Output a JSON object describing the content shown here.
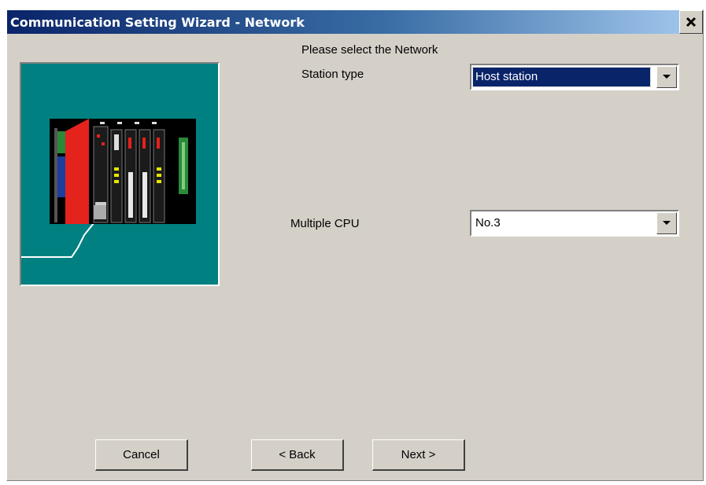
{
  "window": {
    "title": "Communication Setting Wizard - Network"
  },
  "content": {
    "instruction": "Please select the Network",
    "station_type": {
      "label": "Station type",
      "value": "Host station"
    },
    "multiple_cpu": {
      "label": "Multiple CPU",
      "value": "No.3"
    }
  },
  "buttons": {
    "cancel": "Cancel",
    "back": "< Back",
    "next": "Next >"
  },
  "colors": {
    "title_bar_start": "#0a246a",
    "title_bar_end": "#a6caf0",
    "illustration_bg": "#008080",
    "dialog_bg": "#d4d0c8",
    "plc_cpu_module": "#e4231c"
  },
  "icons": {
    "close": "close-icon",
    "dropdown": "chevron-down-icon",
    "illustration": "plc-rack-illustration"
  }
}
